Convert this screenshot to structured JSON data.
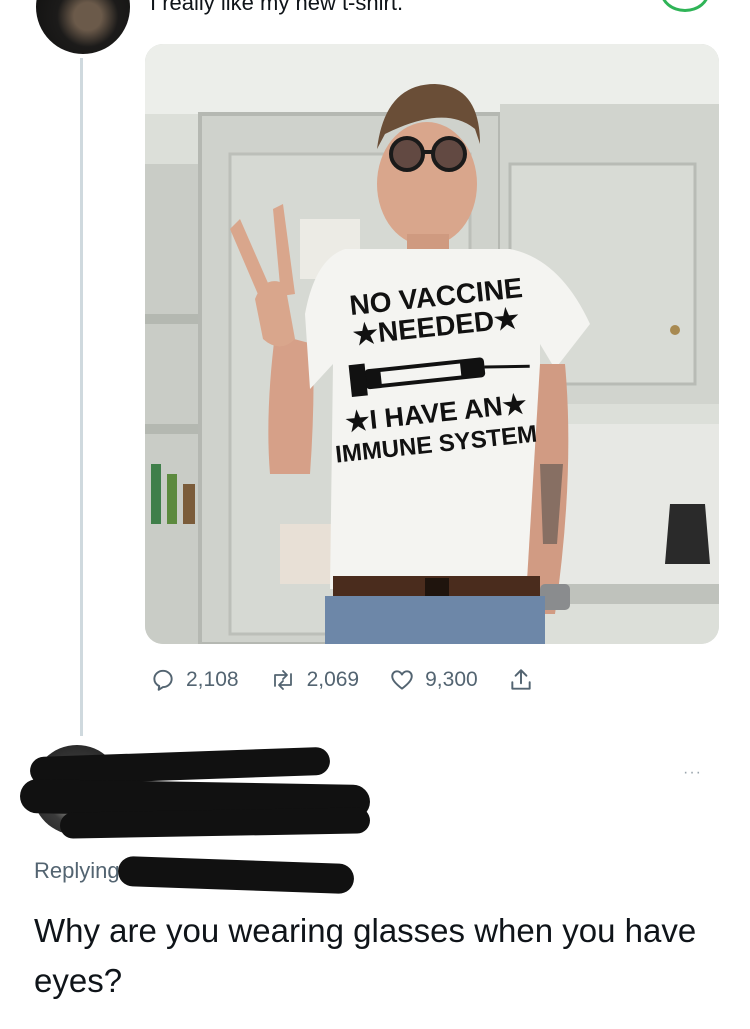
{
  "previous_tweet": {
    "text_cut_off": "I really like my new t-shirt.",
    "image": {
      "shirt_lines": [
        "NO VACCINE",
        "★NEEDED★",
        "★I HAVE AN★",
        "IMMUNE SYSTEM"
      ]
    },
    "stats": {
      "replies": "2,108",
      "retweets": "2,069",
      "likes": "9,300"
    },
    "icons": {
      "reply": "comment-icon",
      "retweet": "retweet-icon",
      "like": "heart-icon",
      "share": "share-icon"
    }
  },
  "reply_tweet": {
    "more": "···",
    "replying_label": "Replying",
    "text": "Why are you wearing glasses when you have eyes?"
  }
}
